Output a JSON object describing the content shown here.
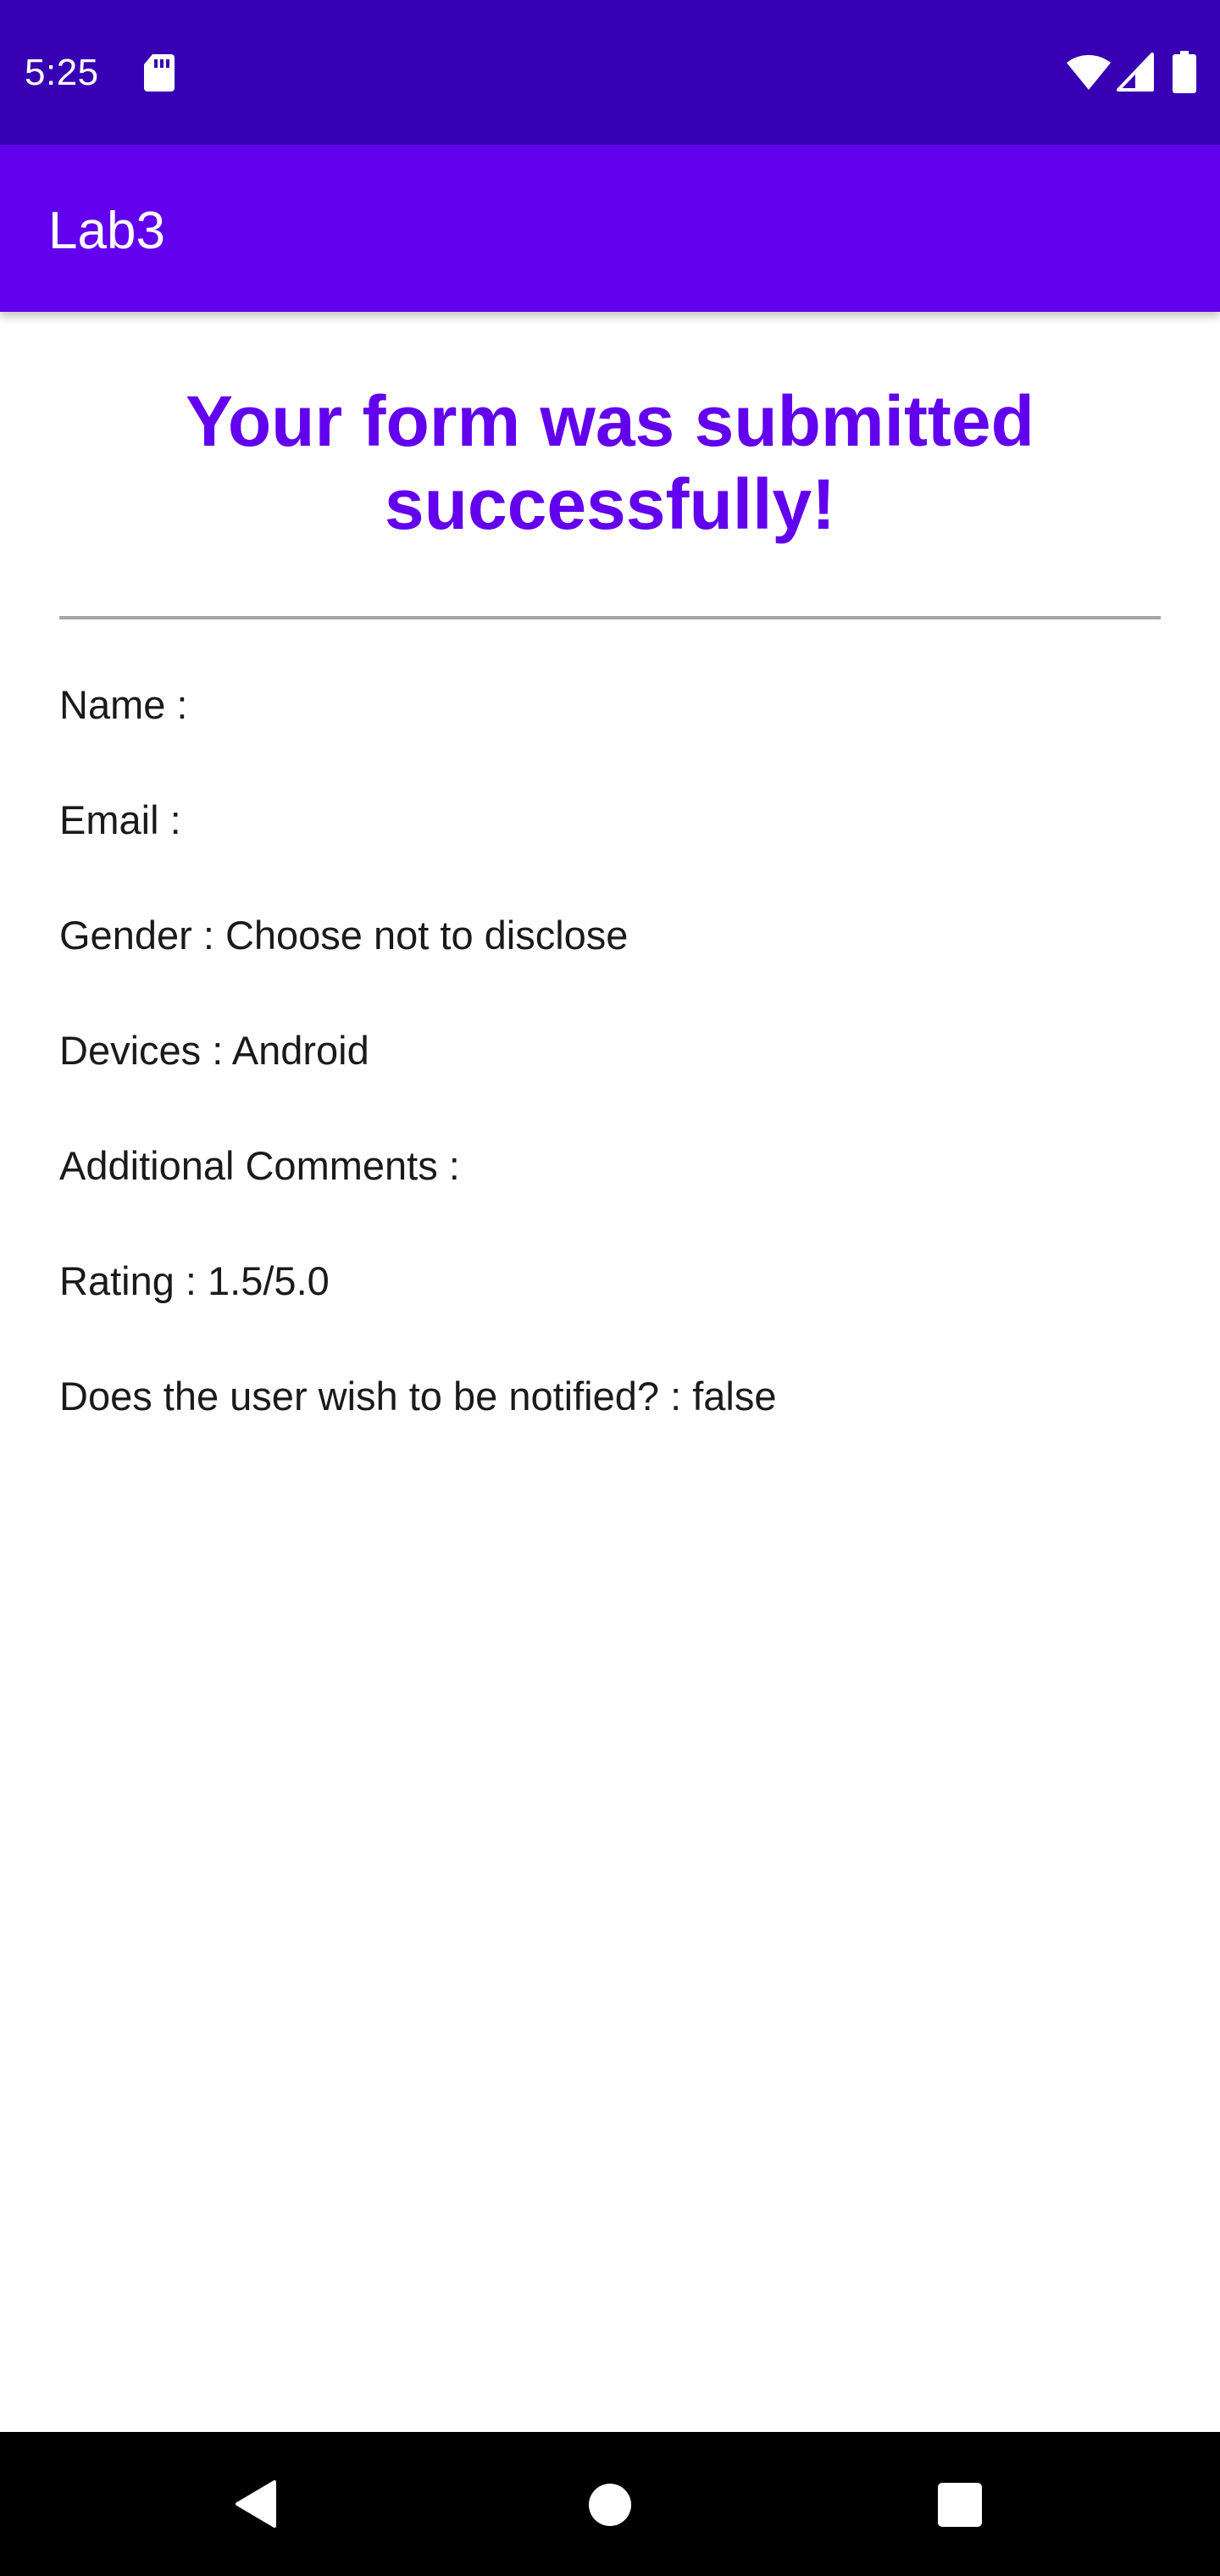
{
  "status_bar": {
    "time": "5:25",
    "icons": [
      "sd-card-icon",
      "wifi-icon",
      "cell-signal-icon",
      "battery-icon"
    ],
    "background": "#3700b3"
  },
  "app_bar": {
    "title": "Lab3",
    "background": "#6200ee"
  },
  "content": {
    "heading": "Your form was submitted successfully!",
    "heading_color": "#6200ee",
    "fields": [
      "Name :",
      "Email :",
      "Gender : Choose not to disclose",
      "Devices : Android",
      "Additional Comments :",
      "Rating : 1.5/5.0",
      "Does the user wish to be notified? : false"
    ]
  },
  "nav_bar": {
    "icons": [
      "back-icon",
      "home-icon",
      "recents-icon"
    ]
  }
}
